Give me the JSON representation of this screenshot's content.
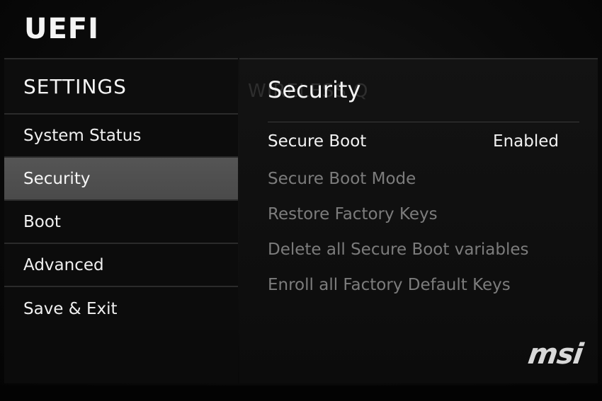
{
  "app": {
    "title": "UEFI"
  },
  "sidebar": {
    "header": "SETTINGS",
    "items": [
      {
        "label": "System Status",
        "active": false
      },
      {
        "label": "Security",
        "active": true
      },
      {
        "label": "Boot",
        "active": false
      },
      {
        "label": "Advanced",
        "active": false
      },
      {
        "label": "Save & Exit",
        "active": false
      }
    ]
  },
  "panel": {
    "title": "Security",
    "title_ghost": "WIRELESS Q",
    "options": [
      {
        "label": "Secure Boot",
        "value": "Enabled",
        "enabled": true
      },
      {
        "label": "Secure Boot Mode",
        "enabled": false
      },
      {
        "label": "Restore Factory Keys",
        "enabled": false
      },
      {
        "label": "Delete all Secure Boot variables",
        "enabled": false
      },
      {
        "label": "Enroll all Factory Default Keys",
        "enabled": false
      }
    ]
  },
  "brand": {
    "logo": "msi"
  },
  "colors": {
    "background": "#0a0a0a",
    "active_item": "#4f4f4f",
    "text": "#f2f2f2",
    "disabled_text": "#7c7c7c",
    "divider": "#2b2b2b"
  }
}
